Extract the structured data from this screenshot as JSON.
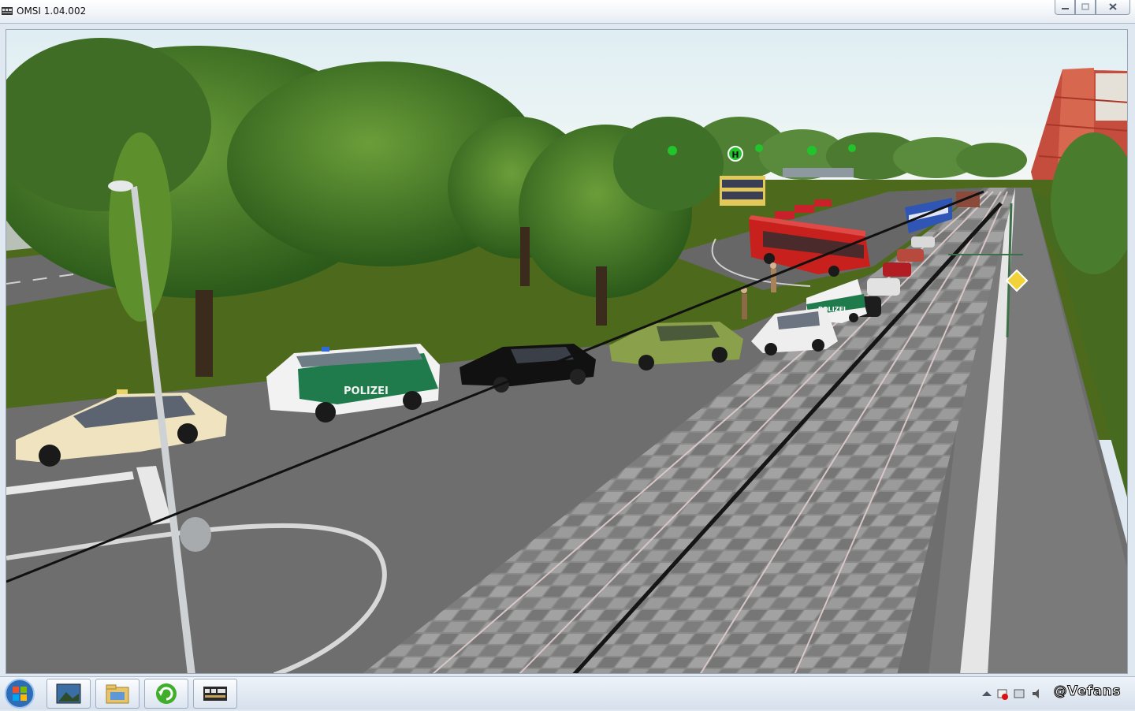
{
  "window": {
    "title": "OMSI 1.04.002"
  },
  "scene": {
    "police_label": "POLIZEI",
    "bus_stop_letter": "H"
  },
  "taskbar": {
    "tray_text": "@Vefans",
    "pinned": [
      "explorer-photo",
      "file-explorer",
      "refresh-app",
      "omsi-app"
    ]
  },
  "colors": {
    "sky": "#e8f2f5",
    "grass": "#4d6a1c",
    "road": "#6e6e6e",
    "police_green": "#1f7a4c",
    "bus_red": "#c8201d",
    "taxi": "#efe3c0",
    "brick": "#c85848"
  }
}
